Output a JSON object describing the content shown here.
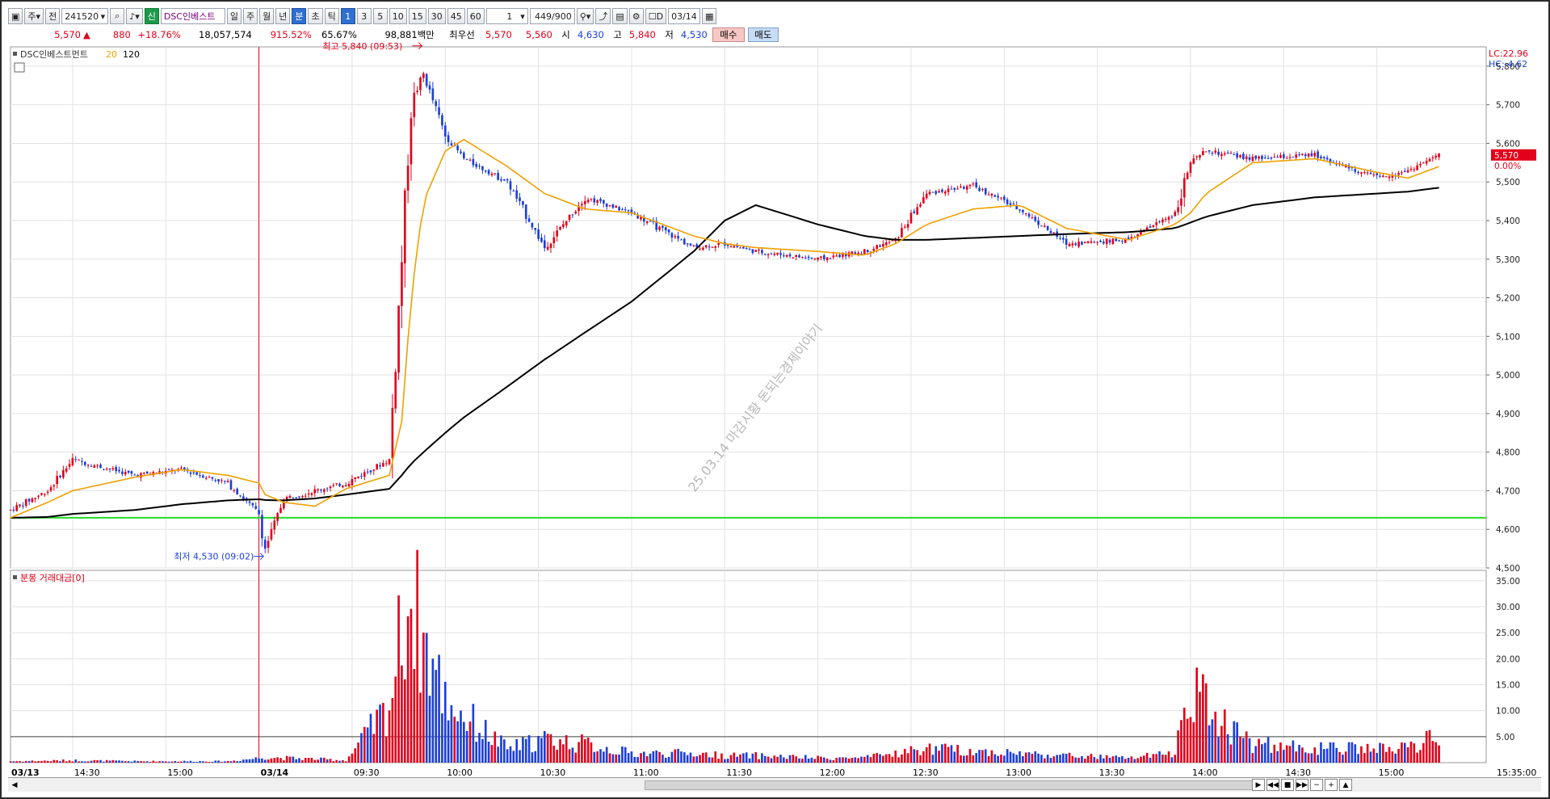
{
  "toolbar": {
    "mode1": "주",
    "mode2": "전",
    "code": "241520",
    "badge": "신",
    "stock_name": "DSC인베스트",
    "periods": [
      "일",
      "주",
      "월",
      "년",
      "분",
      "초",
      "틱"
    ],
    "active_period": "분",
    "intervals": [
      "1",
      "3",
      "5",
      "10",
      "15",
      "30",
      "45",
      "60"
    ],
    "active_interval": "1",
    "interval_select": "1",
    "count": "449",
    "count_max": "/900",
    "date_check": "D",
    "date": "03/14"
  },
  "info": {
    "price": "5,570",
    "change": "880",
    "pct": "+18.76%",
    "volume": "18,057,574",
    "vol_ratio": "915.52%",
    "turnover": "65.67%",
    "amount": "98,881백만",
    "best_label": "최우선",
    "best_ask": "5,570",
    "best_bid": "5,560",
    "open_label": "시",
    "open": "4,630",
    "high_label": "고",
    "high": "5,840",
    "low_label": "저",
    "low": "4,530",
    "buy_label": "매수",
    "sell_label": "매도"
  },
  "price_panel": {
    "legend_name": "DSC인베스트먼트",
    "ma1": "20",
    "ma2": "120",
    "lc": "LC:22.96",
    "hc": "HC:-4.62",
    "current_price": "5,570",
    "current_pct": "0.00%",
    "high_annotation": "최고 5,840 (09:53)",
    "low_annotation": "최저 4,530 (09:02)",
    "watermark": "25.03.14 마감시황 돈되는경제이야기",
    "price_ticks": [
      "5,800",
      "5,700",
      "5,600",
      "5,500",
      "5,400",
      "5,300",
      "5,200",
      "5,100",
      "5,000",
      "4,900",
      "4,800",
      "4,700",
      "4,600",
      "4,500"
    ]
  },
  "volume_panel": {
    "legend": "분봉 거래대금[0]",
    "ticks": [
      "35.00",
      "30.00",
      "25.00",
      "20.00",
      "15.00",
      "10.00",
      "5.00"
    ]
  },
  "time_axis": {
    "labels": [
      "03/13",
      "14:30",
      "15:00",
      "03/14",
      "09:30",
      "10:00",
      "10:30",
      "11:00",
      "11:30",
      "12:00",
      "12:30",
      "13:00",
      "13:30",
      "14:00",
      "14:30",
      "15:00"
    ],
    "end_time": "15:35:00"
  },
  "colors": {
    "up": "#e2001a",
    "down": "#1c3fd8",
    "ma20": "#f0a000",
    "ma120": "#000000",
    "support": "#22dd22"
  },
  "chart_data": {
    "type": "candlestick",
    "price_range": [
      4500,
      5850
    ],
    "volume_range": [
      0,
      37
    ],
    "support_price": 4630,
    "current_price": 5570,
    "high": 5840,
    "low": 4530,
    "anchors": [
      {
        "t": "13 14:10",
        "p": 4650,
        "ma20": 4630,
        "ma120": 4630,
        "v": 0.3
      },
      {
        "t": "13 14:22",
        "p": 4700,
        "ma20": 4670,
        "ma120": 4632,
        "v": 0.4
      },
      {
        "t": "13 14:30",
        "p": 4780,
        "ma20": 4700,
        "ma120": 4640,
        "v": 0.5
      },
      {
        "t": "13 14:50",
        "p": 4740,
        "ma20": 4735,
        "ma120": 4650,
        "v": 0.3
      },
      {
        "t": "13 15:05",
        "p": 4755,
        "ma20": 4755,
        "ma120": 4665,
        "v": 0.3
      },
      {
        "t": "13 15:20",
        "p": 4720,
        "ma20": 4740,
        "ma120": 4675,
        "v": 0.3
      },
      {
        "t": "14 09:00",
        "p": 4640,
        "ma20": 4720,
        "ma120": 4678,
        "v": 1.0
      },
      {
        "t": "14 09:02",
        "p": 4550,
        "ma20": 4690,
        "ma120": 4676,
        "v": 1.2
      },
      {
        "t": "14 09:08",
        "p": 4680,
        "ma20": 4670,
        "ma120": 4675,
        "v": 1.0
      },
      {
        "t": "14 09:18",
        "p": 4700,
        "ma20": 4660,
        "ma120": 4680,
        "v": 0.8
      },
      {
        "t": "14 09:28",
        "p": 4720,
        "ma20": 4705,
        "ma120": 4690,
        "v": 0.5
      },
      {
        "t": "14 09:42",
        "p": 4780,
        "ma20": 4740,
        "ma120": 4705,
        "v": 12.0
      },
      {
        "t": "14 09:46",
        "p": 5300,
        "ma20": 4880,
        "ma120": 4740,
        "v": 29.0
      },
      {
        "t": "14 09:49",
        "p": 5700,
        "ma20": 5200,
        "ma120": 4770,
        "v": 36.0
      },
      {
        "t": "14 09:53",
        "p": 5780,
        "ma20": 5450,
        "ma120": 4800,
        "v": 26.0
      },
      {
        "t": "14 10:00",
        "p": 5620,
        "ma20": 5580,
        "ma120": 4850,
        "v": 14.0
      },
      {
        "t": "14 10:06",
        "p": 5560,
        "ma20": 5610,
        "ma120": 4890,
        "v": 10.0
      },
      {
        "t": "14 10:20",
        "p": 5500,
        "ma20": 5540,
        "ma120": 4970,
        "v": 3.0
      },
      {
        "t": "14 10:32",
        "p": 5330,
        "ma20": 5470,
        "ma120": 5040,
        "v": 5.0
      },
      {
        "t": "14 10:45",
        "p": 5460,
        "ma20": 5430,
        "ma120": 5110,
        "v": 4.0
      },
      {
        "t": "14 11:00",
        "p": 5420,
        "ma20": 5420,
        "ma120": 5190,
        "v": 2.0
      },
      {
        "t": "14 11:20",
        "p": 5330,
        "ma20": 5360,
        "ma120": 5320,
        "v": 2.0
      },
      {
        "t": "14 11:30",
        "p": 5340,
        "ma20": 5340,
        "ma120": 5400,
        "v": 1.5
      },
      {
        "t": "14 11:40",
        "p": 5320,
        "ma20": 5330,
        "ma120": 5440,
        "v": 1.5
      },
      {
        "t": "14 12:00",
        "p": 5300,
        "ma20": 5320,
        "ma120": 5390,
        "v": 1.0
      },
      {
        "t": "14 12:15",
        "p": 5320,
        "ma20": 5310,
        "ma120": 5360,
        "v": 1.0
      },
      {
        "t": "14 12:25",
        "p": 5350,
        "ma20": 5340,
        "ma120": 5350,
        "v": 2.0
      },
      {
        "t": "14 12:35",
        "p": 5470,
        "ma20": 5390,
        "ma120": 5350,
        "v": 3.0
      },
      {
        "t": "14 12:50",
        "p": 5490,
        "ma20": 5430,
        "ma120": 5355,
        "v": 2.5
      },
      {
        "t": "14 13:05",
        "p": 5430,
        "ma20": 5440,
        "ma120": 5360,
        "v": 2.0
      },
      {
        "t": "14 13:20",
        "p": 5340,
        "ma20": 5380,
        "ma120": 5365,
        "v": 1.5
      },
      {
        "t": "14 13:40",
        "p": 5350,
        "ma20": 5350,
        "ma120": 5370,
        "v": 1.0
      },
      {
        "t": "14 13:55",
        "p": 5420,
        "ma20": 5390,
        "ma120": 5380,
        "v": 2.0
      },
      {
        "t": "14 14:00",
        "p": 5550,
        "ma20": 5420,
        "ma120": 5395,
        "v": 18.0
      },
      {
        "t": "14 14:05",
        "p": 5580,
        "ma20": 5470,
        "ma120": 5410,
        "v": 12.0
      },
      {
        "t": "14 14:20",
        "p": 5560,
        "ma20": 5550,
        "ma120": 5440,
        "v": 4.0
      },
      {
        "t": "14 14:40",
        "p": 5570,
        "ma20": 5560,
        "ma120": 5460,
        "v": 3.0
      },
      {
        "t": "14 15:00",
        "p": 5510,
        "ma20": 5525,
        "ma120": 5470,
        "v": 3.0
      },
      {
        "t": "14 15:10",
        "p": 5530,
        "ma20": 5510,
        "ma120": 5475,
        "v": 3.0
      },
      {
        "t": "14 15:20",
        "p": 5570,
        "ma20": 5540,
        "ma120": 5485,
        "v": 6.0
      }
    ]
  }
}
